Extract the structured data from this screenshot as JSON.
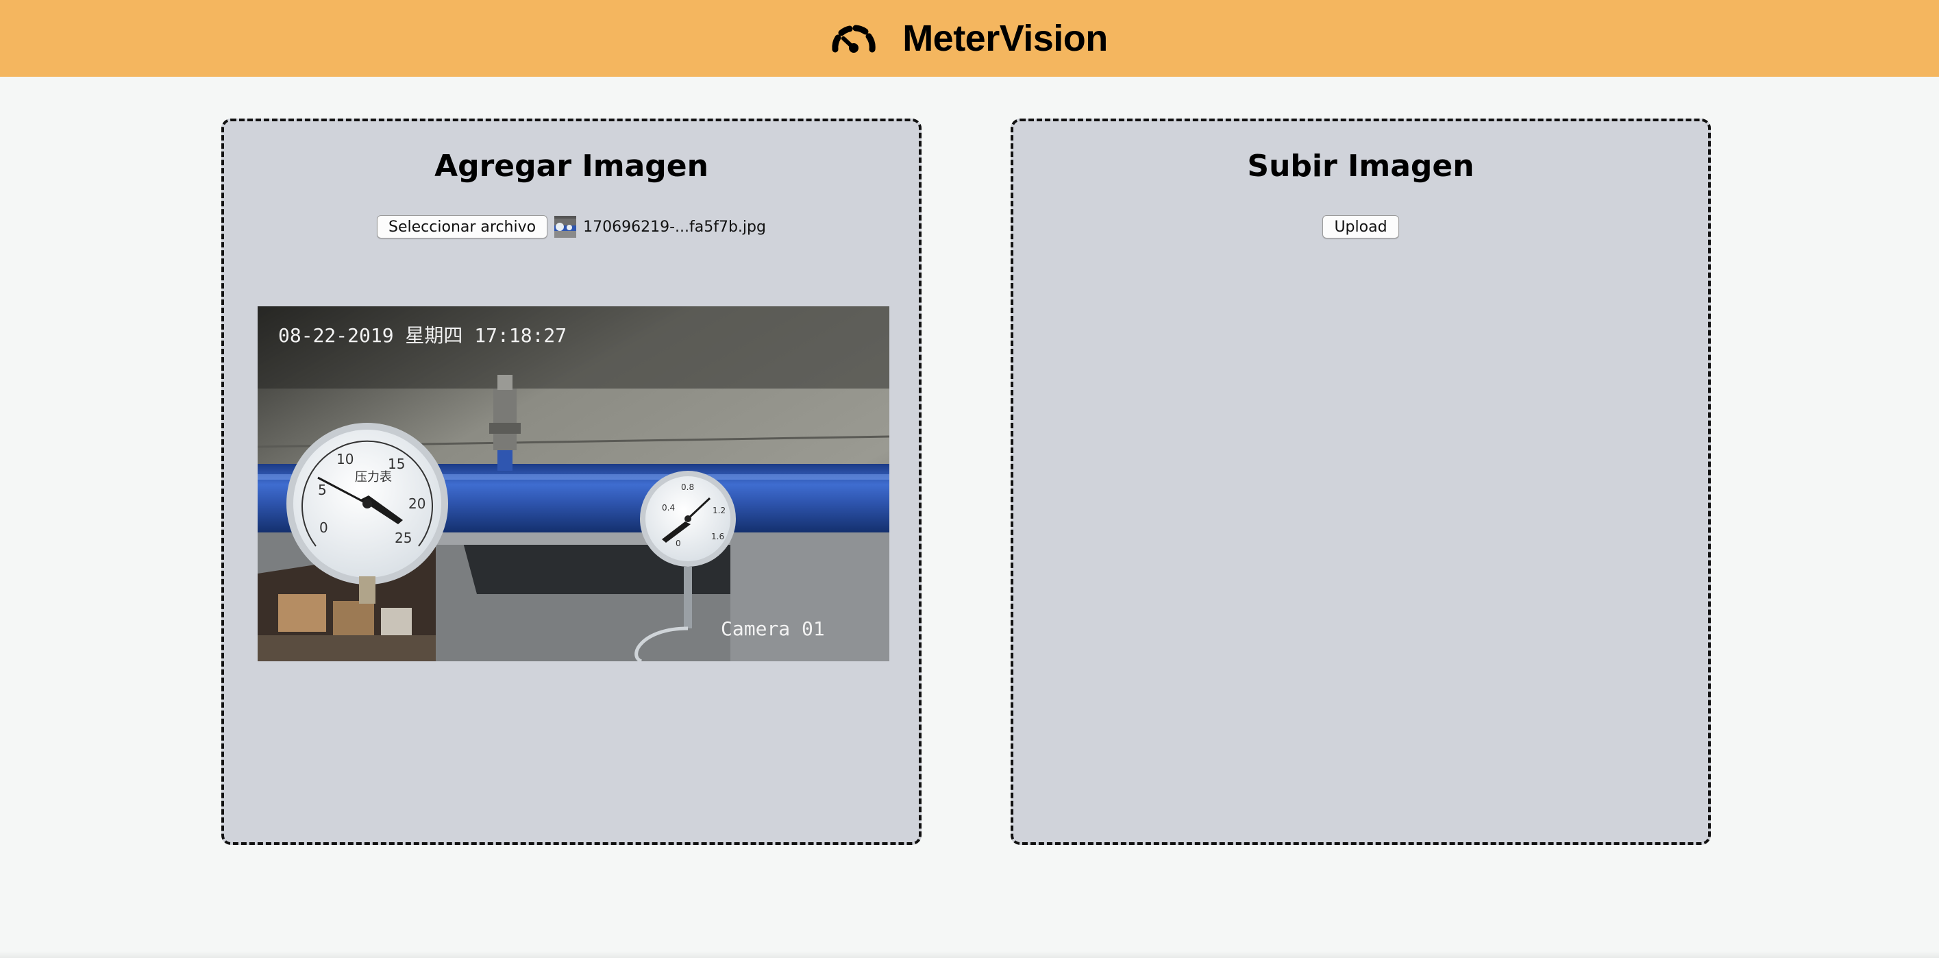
{
  "header": {
    "brand": "MeterVision",
    "logo_icon": "gauge-icon",
    "background": "#f4b65f"
  },
  "left_panel": {
    "title": "Agregar Imagen",
    "file_button_label": "Seleccionar archivo",
    "selected_file": "170696219-...fa5f7b.jpg",
    "preview": {
      "timestamp": "08-22-2019 星期四 17:18:27",
      "camera_label": "Camera 01",
      "gauge_large_title": "压力表",
      "gauge_large_ticks": [
        "0",
        "5",
        "10",
        "15",
        "20",
        "25"
      ],
      "gauge_small_ticks": [
        "0",
        "0.4",
        "0.8",
        "1.2",
        "1.6"
      ]
    }
  },
  "right_panel": {
    "title": "Subir Imagen",
    "upload_label": "Upload"
  },
  "colors": {
    "page_bg": "#f5f7f6",
    "panel_bg": "#d0d3da",
    "pipe_blue": "#2f56b0"
  }
}
